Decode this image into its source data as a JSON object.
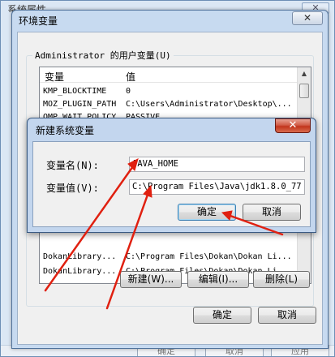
{
  "background_window": {
    "title": "系统属性",
    "close_label": "✕",
    "bottom_buttons": [
      "确定",
      "取消",
      "应用"
    ]
  },
  "env_window": {
    "title": "环境变量",
    "close_label": "✕",
    "user_vars_label": "Administrator 的用户变量(U)",
    "columns": [
      "变量",
      "值"
    ],
    "user_rows": [
      {
        "name": "KMP_BLOCKTIME",
        "value": "0"
      },
      {
        "name": "MOZ_PLUGIN_PATH",
        "value": "C:\\Users\\Administrator\\Desktop\\..."
      },
      {
        "name": "OMP_WAIT_POLICY",
        "value": "PASSIVE"
      }
    ],
    "system_rows": [
      {
        "name": "DokanLibrary...",
        "value": "C:\\Program Files\\Dokan\\Dokan Li..."
      },
      {
        "name": "DokanLibrary...",
        "value": "C:\\Program Files\\Dokan\\Dokan Li..."
      }
    ],
    "buttons": {
      "new": "新建(W)...",
      "edit": "编辑(I)...",
      "delete": "删除(L)",
      "ok": "确定",
      "cancel": "取消"
    }
  },
  "new_var_dialog": {
    "title": "新建系统变量",
    "close_label": "✕",
    "name_label": "变量名(N):",
    "value_label": "变量值(V):",
    "name_value": "JAVA_HOME",
    "value_value": "C:\\Program Files\\Java\\jdk1.8.0_77",
    "ok": "确定",
    "cancel": "取消"
  },
  "annotation_color": "#e02010"
}
